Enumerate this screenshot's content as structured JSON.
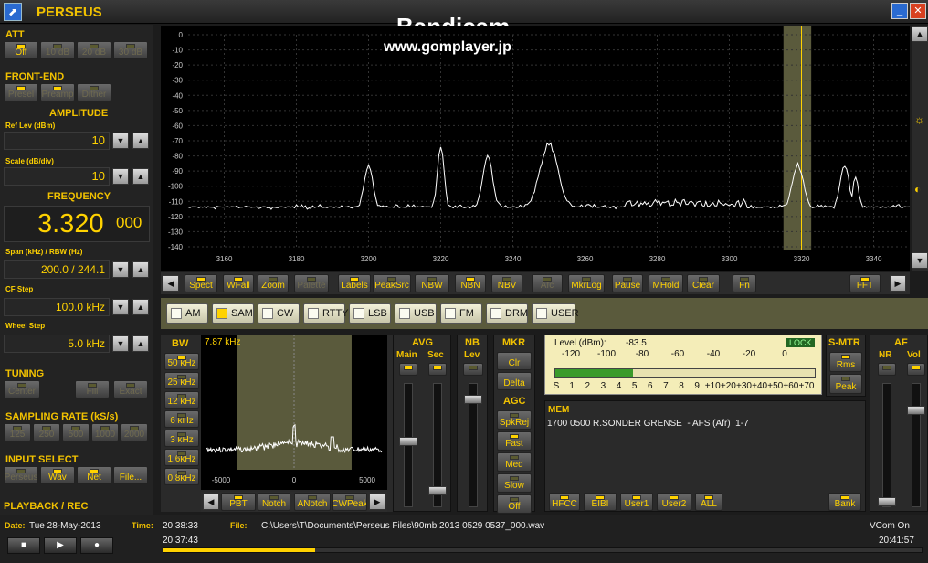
{
  "app": {
    "title": "PERSEUS",
    "overlay_title": "Bandicam",
    "overlay_url": "www.gomplayer.jp"
  },
  "left": {
    "att": {
      "title": "ATT",
      "buttons": [
        "Off",
        "10 dB",
        "20 dB",
        "30 dB"
      ]
    },
    "frontend": {
      "title": "FRONT-END",
      "buttons": [
        "Presel",
        "Preamp",
        "Dither"
      ]
    },
    "amplitude": {
      "title": "AMPLITUDE",
      "ref_label": "Ref Lev (dBm)",
      "ref_value": "10",
      "scale_label": "Scale (dB/div)",
      "scale_value": "10"
    },
    "frequency": {
      "title": "FREQUENCY",
      "main": "3.320",
      "fine": "000",
      "span_label": "Span (kHz) / RBW (Hz)",
      "span_value": "200.0 / 244.1",
      "cf_label": "CF Step",
      "cf_value": "100.0 kHz",
      "wheel_label": "Wheel Step",
      "wheel_value": "5.0 kHz"
    },
    "tuning": {
      "title": "TUNING",
      "buttons": [
        "Center",
        "Fill",
        "Exact"
      ]
    },
    "sampling": {
      "title": "SAMPLING RATE (kS/s)",
      "buttons": [
        "125",
        "250",
        "500",
        "1000",
        "2000"
      ]
    },
    "input": {
      "title": "INPUT SELECT",
      "buttons": [
        "Perseus",
        "Wav",
        "Net",
        "File..."
      ]
    },
    "playback": "PLAYBACK / REC"
  },
  "spectrum": {
    "y_ticks": [
      "0",
      "-10",
      "-20",
      "-30",
      "-40",
      "-50",
      "-60",
      "-70",
      "-80",
      "-90",
      "-100",
      "-110",
      "-120",
      "-130",
      "-140"
    ],
    "x_ticks": [
      "3160",
      "3180",
      "3200",
      "3220",
      "3240",
      "3260",
      "3280",
      "3300",
      "3320",
      "3340"
    ],
    "toolbar": [
      "Spect",
      "WFall",
      "Zoom",
      "Palette",
      "Labels",
      "PeakSrc",
      "NBW",
      "NBN",
      "NBV",
      "Afc",
      "MkrLog",
      "Pause",
      "MHold",
      "Clear",
      "Fn",
      "FFT"
    ]
  },
  "modes": [
    "AM",
    "SAM",
    "CW",
    "RTTY",
    "LSB",
    "USB",
    "FM",
    "DRM",
    "USER"
  ],
  "bw": {
    "title": "BW",
    "buttons": [
      "50 kHz",
      "25 kHz",
      "12 kHz",
      "6 kHz",
      "3 kHz",
      "1.6kHz",
      "0.8kHz"
    ],
    "readout": "7.87 kHz",
    "x_ticks": [
      "-5000",
      "0",
      "5000"
    ],
    "toolbar": [
      "PBT",
      "Notch",
      "ANotch",
      "CWPeak"
    ]
  },
  "avg": {
    "title": "AVG",
    "main": "Main",
    "sec": "Sec"
  },
  "nb": {
    "title": "NB",
    "lev": "Lev"
  },
  "mkr": {
    "title": "MKR",
    "buttons": [
      "Clr",
      "Delta"
    ]
  },
  "agc": {
    "title": "AGC",
    "buttons": [
      "SpkRej",
      "Fast",
      "Med",
      "Slow",
      "Off"
    ]
  },
  "meter": {
    "level_label": "Level (dBm):",
    "level_value": "-83.5",
    "lock": "LOCK",
    "scale_top": [
      "-120",
      "-100",
      "-80",
      "-60",
      "-40",
      "-20",
      "0"
    ],
    "scale_bottom": [
      "S",
      "1",
      "2",
      "3",
      "4",
      "5",
      "6",
      "7",
      "8",
      "9",
      "+10",
      "+20",
      "+30",
      "+40",
      "+50",
      "+60",
      "+70"
    ],
    "fill": 0.3
  },
  "smtr": {
    "title": "S-MTR",
    "buttons": [
      "Rms",
      "Peak"
    ]
  },
  "af": {
    "title": "AF",
    "nr": "NR",
    "vol": "Vol"
  },
  "mem": {
    "title": "MEM",
    "entry": "1700 0500 R.SONDER GRENSE  - AFS (Afr)  1-7",
    "buttons": [
      "HFCC",
      "EIBI",
      "User1",
      "User2",
      "ALL",
      "Bank"
    ]
  },
  "status": {
    "date_label": "Date:",
    "date": "Tue 28-May-2013",
    "time_label": "Time:",
    "time": "20:38:33",
    "file_label": "File:",
    "file": "C:\\Users\\T\\Documents\\Perseus Files\\90mb 2013 0529 0537_000.wav",
    "vcom": "VCom On",
    "pos": "20:37:43",
    "end": "20:41:57",
    "progress": 0.2
  },
  "colors": {
    "accent": "#ffd200",
    "spectrum_bg": "#000000",
    "passband": "#5a5a3c"
  }
}
